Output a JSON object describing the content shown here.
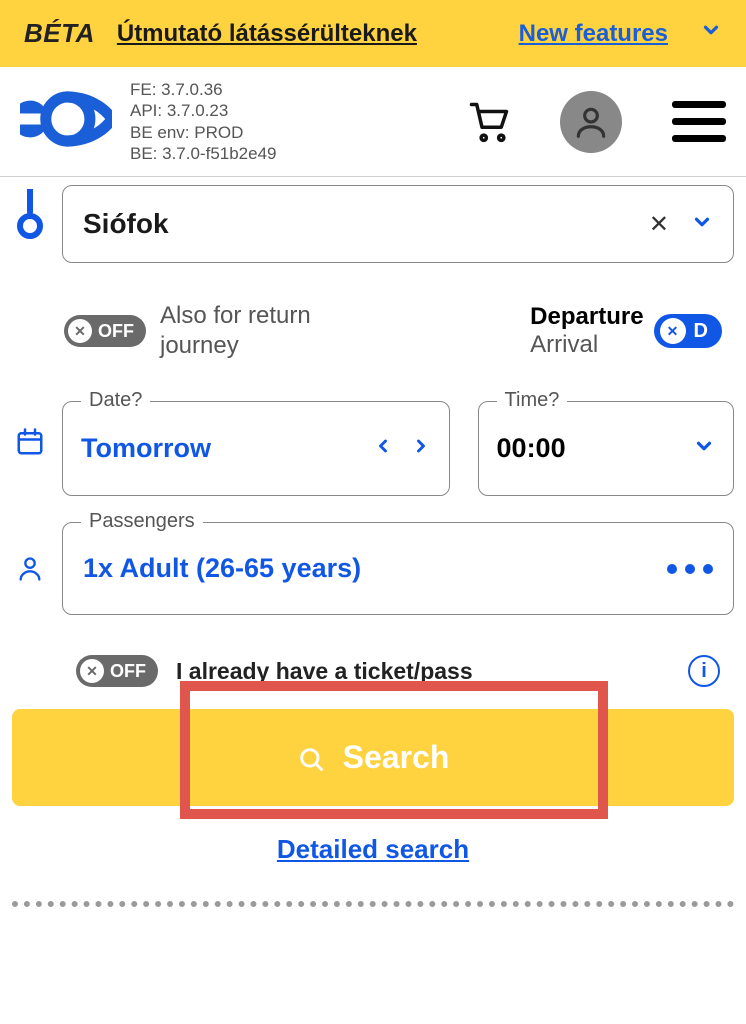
{
  "banner": {
    "beta": "BÉTA",
    "guide": "Útmutató látássérülteknek",
    "new_features": "New features"
  },
  "versions": {
    "fe": "FE: 3.7.0.36",
    "api": "API: 3.7.0.23",
    "be_env": "BE env: PROD",
    "be": "BE: 3.7.0-f51b2e49"
  },
  "station": {
    "name": "Siófok"
  },
  "return_toggle": {
    "state": "OFF",
    "label": "Also for return journey"
  },
  "dep_arr": {
    "departure": "Departure",
    "arrival": "Arrival",
    "pill_letter": "D"
  },
  "date": {
    "legend": "Date?",
    "value": "Tomorrow"
  },
  "time": {
    "legend": "Time?",
    "value": "00:00"
  },
  "passengers": {
    "legend": "Passengers",
    "summary": "1x Adult (26-65 years)"
  },
  "ticket_toggle": {
    "state": "OFF",
    "label": "I already have a ticket/pass"
  },
  "search": {
    "label": "Search"
  },
  "detailed_search": "Detailed search"
}
